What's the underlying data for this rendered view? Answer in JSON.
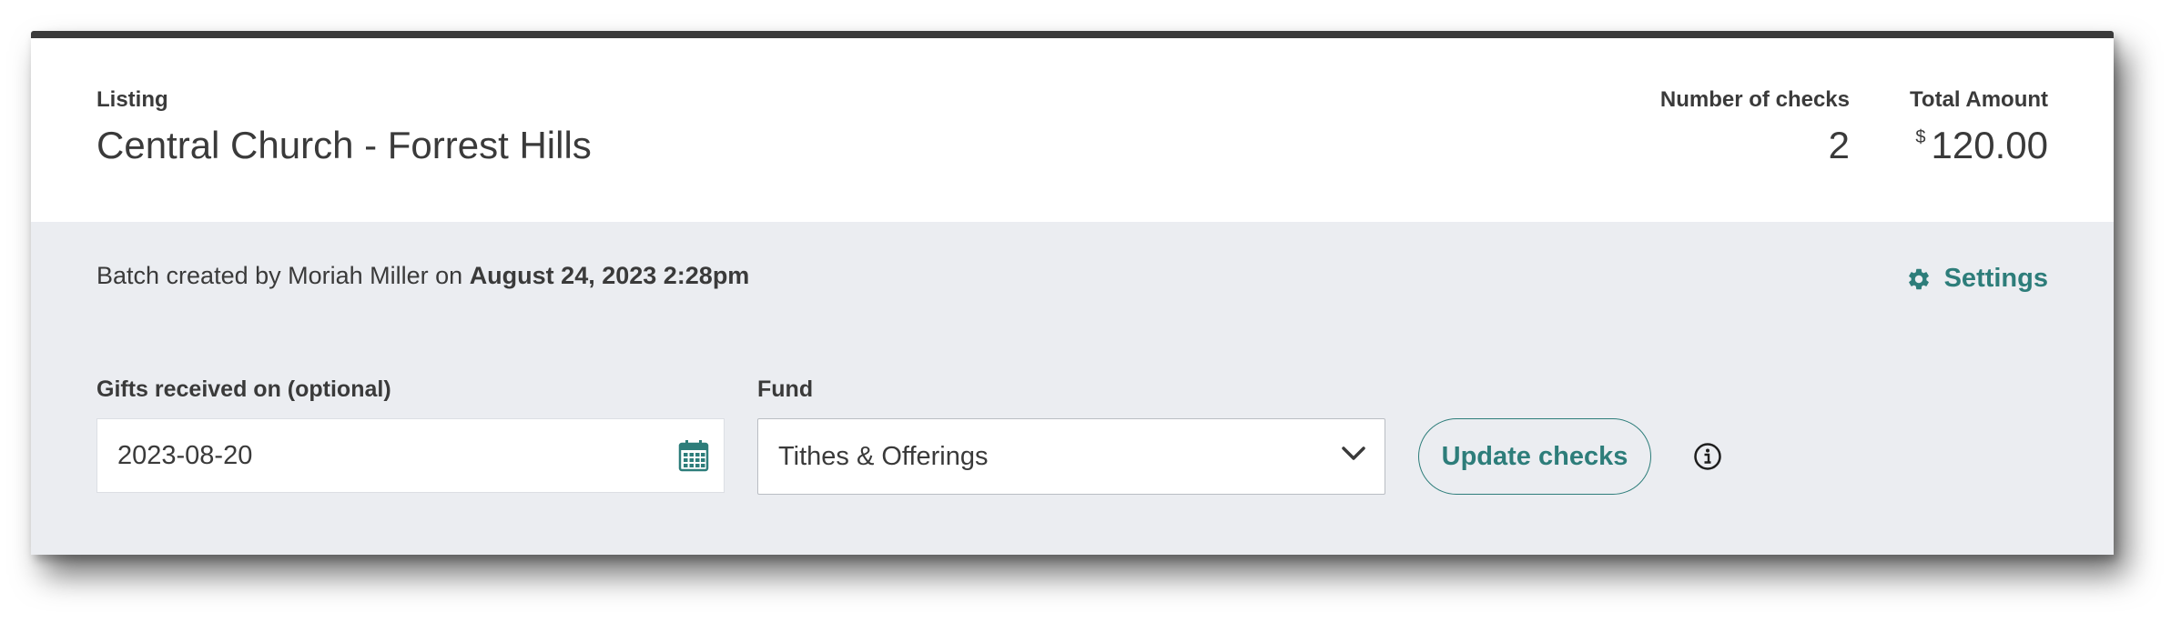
{
  "header": {
    "listing_label": "Listing",
    "listing_name": "Central Church - Forrest Hills",
    "checks_label": "Number of checks",
    "checks_value": "2",
    "total_label": "Total Amount",
    "total_currency": "$",
    "total_value": "120.00"
  },
  "batch": {
    "created_prefix": "Batch created by Moriah Miller on ",
    "created_datetime": "August 24, 2023 2:28pm"
  },
  "settings": {
    "label": "Settings",
    "icon": "gear-icon"
  },
  "form": {
    "date_label": "Gifts received on (optional)",
    "date_value": "2023-08-20",
    "date_icon": "calendar-icon",
    "fund_label": "Fund",
    "fund_value": "Tithes & Offerings",
    "fund_icon": "chevron-down-icon",
    "update_label": "Update checks",
    "info_icon": "info-icon"
  },
  "colors": {
    "accent": "#2d7d7a",
    "panel_bg": "#ebedf1",
    "top_border": "#3a3a3a"
  }
}
